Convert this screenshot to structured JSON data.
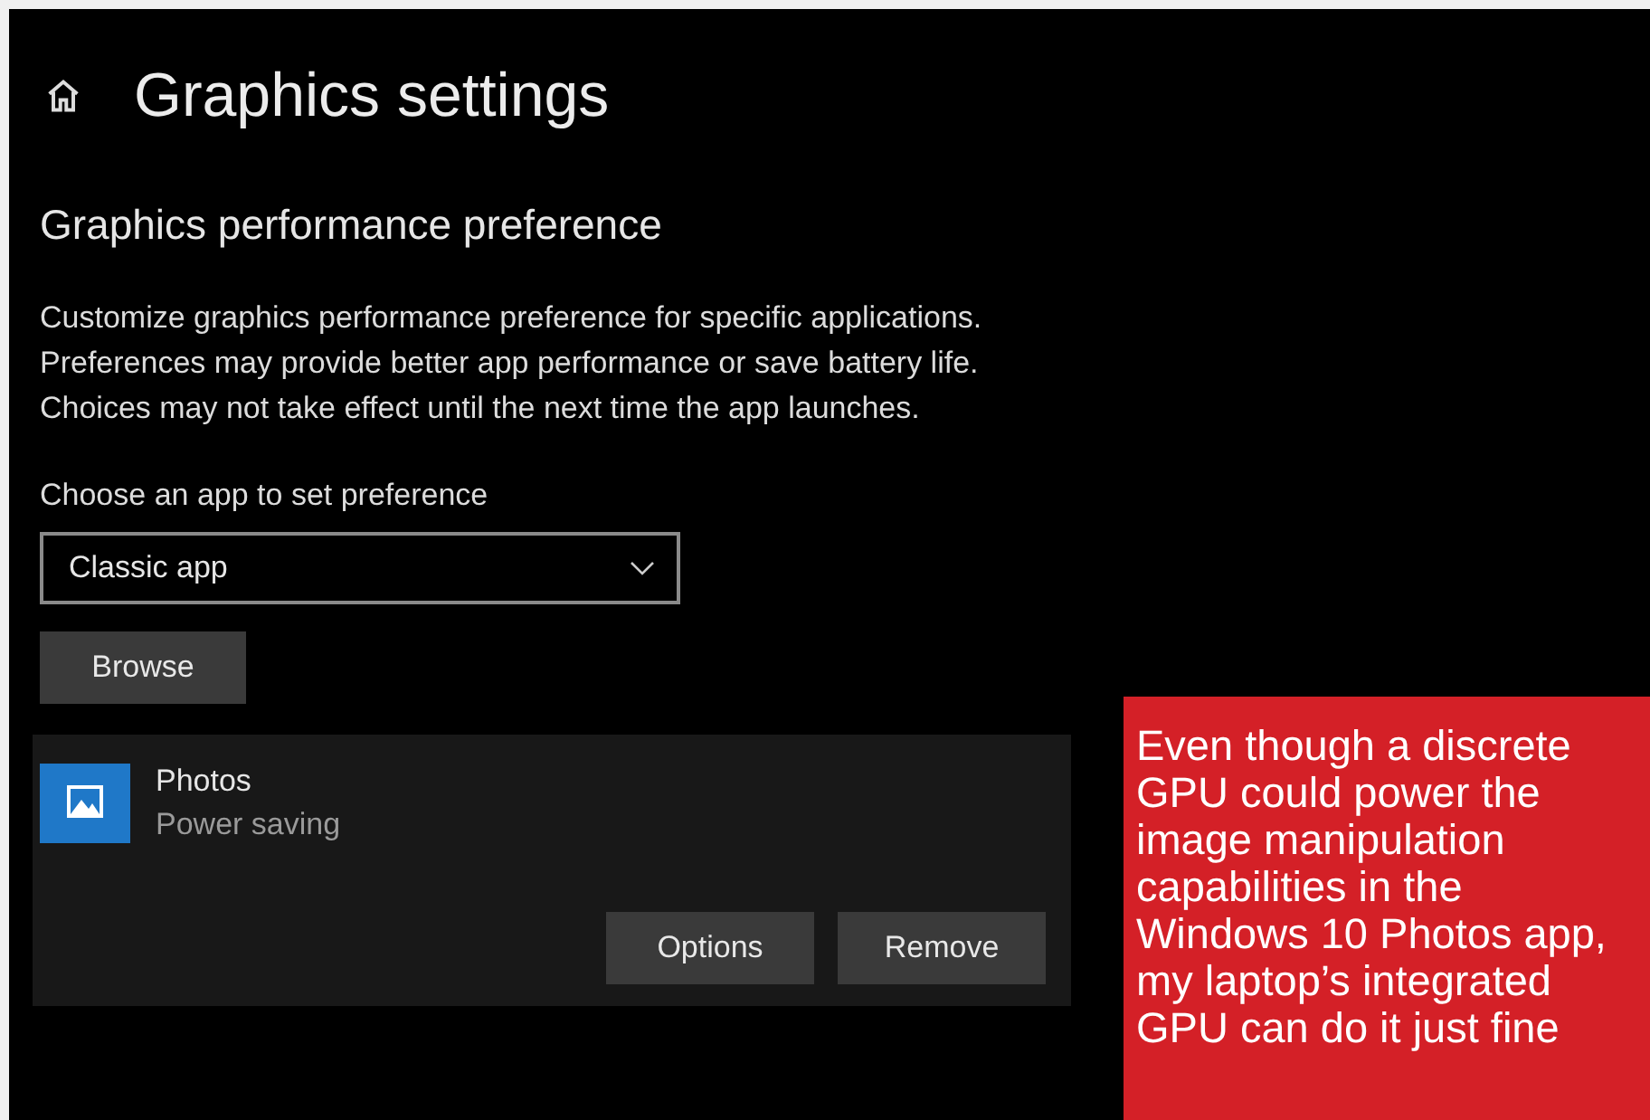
{
  "page": {
    "title": "Graphics settings"
  },
  "section": {
    "heading": "Graphics performance preference",
    "description": "Customize graphics performance preference for specific applications. Preferences may provide better app performance or save battery life. Choices may not take effect until the next time the app launches."
  },
  "app_chooser": {
    "label": "Choose an app to set preference",
    "value": "Classic app",
    "browse_button": "Browse"
  },
  "apps": [
    {
      "name": "Photos",
      "preference": "Power saving",
      "buttons": [
        "Options",
        "Remove"
      ]
    }
  ],
  "caption": "Even though a discrete GPU could power the image manipulation capabilities in the Windows 10 Photos app, my laptop’s integrated GPU can do it just fine"
}
